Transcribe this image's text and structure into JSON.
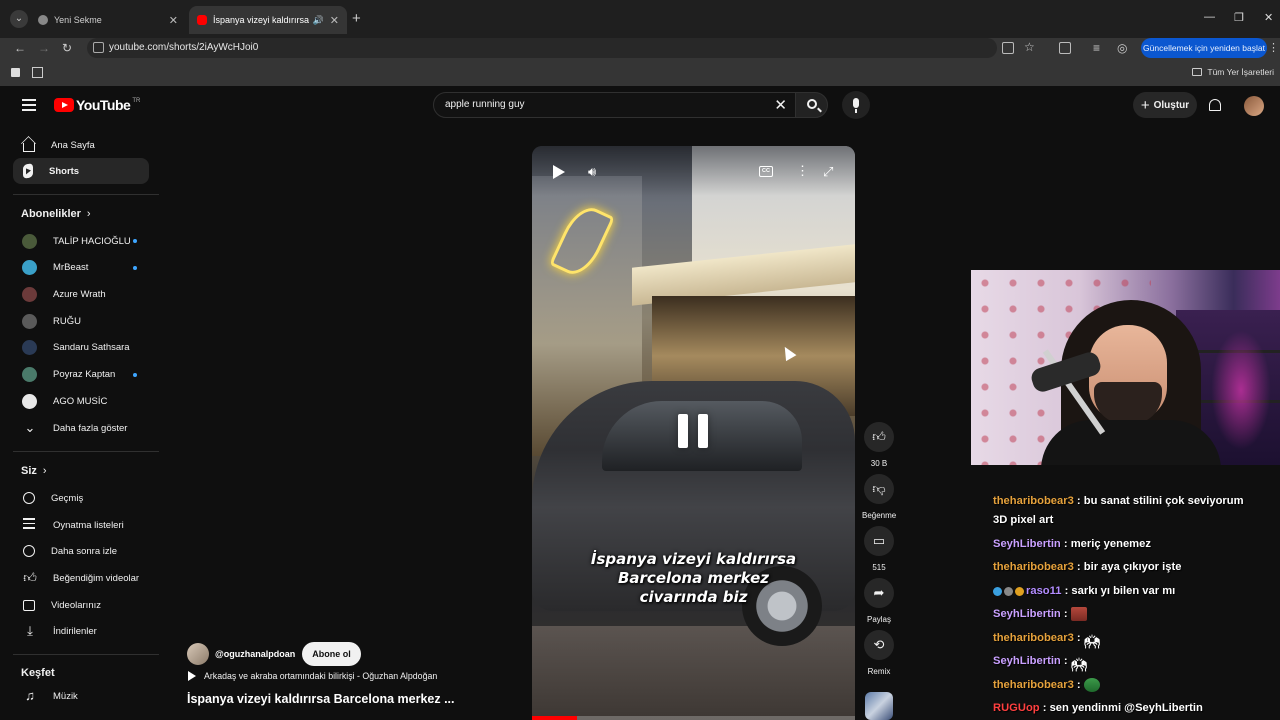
{
  "browser": {
    "tabs": [
      {
        "title": "Yeni Sekme",
        "active": false
      },
      {
        "title": "İspanya vizeyi kaldırırsa Barcelona merkez civarında biz",
        "active": true,
        "audible": true
      }
    ],
    "url": "youtube.com/shorts/2iAyWcHJoi0",
    "update_button": "Güncellemek için yeniden başlat",
    "all_bookmarks": "Tüm Yer İşaretleri",
    "colors": {
      "update": "#0b57d0",
      "tab_strip": "#1f1f1f"
    }
  },
  "youtube": {
    "logo": "YouTube",
    "country_code": "TR",
    "search_query": "apple running guy",
    "create_label": "Oluştur",
    "brand_color": "#ff0000"
  },
  "sidebar": {
    "main": [
      {
        "label": "Ana Sayfa",
        "icon": "home-icon"
      },
      {
        "label": "Shorts",
        "icon": "shorts-icon",
        "active": true
      }
    ],
    "subscriptions_header": "Abonelikler",
    "subscriptions": [
      {
        "label": "TALİP HACIOĞLU",
        "new": true,
        "color": "#4a5a3a"
      },
      {
        "label": "MrBeast",
        "new": true,
        "color": "#3aa0c8"
      },
      {
        "label": "Azure Wrath",
        "new": false,
        "color": "#6b3a3a"
      },
      {
        "label": "RUĞU",
        "new": false,
        "color": "#5a5a5a"
      },
      {
        "label": "Sandaru Sathsara",
        "new": false,
        "color": "#2a3a55"
      },
      {
        "label": "Poyraz Kaptan",
        "new": true,
        "color": "#4a7a6a"
      },
      {
        "label": "AGO MUSİC",
        "new": false,
        "color": "#e8e8e8"
      }
    ],
    "show_more": "Daha fazla göster",
    "you_header": "Siz",
    "you_items": [
      {
        "label": "Geçmiş",
        "icon": "history-icon"
      },
      {
        "label": "Oynatma listeleri",
        "icon": "playlist-icon"
      },
      {
        "label": "Daha sonra izle",
        "icon": "clock-icon"
      },
      {
        "label": "Beğendiğim videolar",
        "icon": "thumb-up-icon"
      },
      {
        "label": "Videolarınız",
        "icon": "your-videos-icon"
      },
      {
        "label": "İndirilenler",
        "icon": "download-icon"
      }
    ],
    "explore_header": "Keşfet",
    "explore_items": [
      {
        "label": "Müzik",
        "icon": "music-icon"
      }
    ]
  },
  "short": {
    "caption_lines": [
      "İspanya vizeyi kaldırırsa",
      "Barcelona merkez",
      "civarında biz"
    ],
    "channel": "@oguzhanalpdoan",
    "subscribe": "Abone ol",
    "music": "Arkadaş ve akraba ortamındaki bilirkişi - Oğuzhan Alpdoğan",
    "title": "İspanya vizeyi kaldırırsa Barcelona merkez ...",
    "progress_fraction": 0.14,
    "actions": [
      {
        "icon": "thumb-up-icon",
        "label": "30 B"
      },
      {
        "icon": "thumb-down-icon",
        "label": "Beğenme"
      },
      {
        "icon": "comment-icon",
        "label": "515"
      },
      {
        "icon": "share-icon",
        "label": "Paylaş"
      },
      {
        "icon": "remix-icon",
        "label": "Remix"
      }
    ]
  },
  "chat": [
    {
      "user": "theharibobear3",
      "color": "#e6a23c",
      "text": "bu sanat stilini çok seviyorum",
      "text2": "3D pixel art"
    },
    {
      "user": "SeyhLibertin",
      "color": "#c9a0ff",
      "text": "meriç yenemez"
    },
    {
      "user": "theharibobear3",
      "color": "#e6a23c",
      "text": "bir aya çıkıyor işte"
    },
    {
      "user": "raso11",
      "color": "#b28cff",
      "text": "sarkı yı bilen var mı",
      "badges": true
    },
    {
      "user": "SeyhLibertin",
      "color": "#c9a0ff",
      "text": "",
      "emote": "brick"
    },
    {
      "user": "theharibobear3",
      "color": "#e6a23c",
      "text": "",
      "emote": "hand"
    },
    {
      "user": "SeyhLibertin",
      "color": "#c9a0ff",
      "text": "",
      "emote": "hand"
    },
    {
      "user": "theharibobear3",
      "color": "#e6a23c",
      "text": "",
      "emote": "bag"
    },
    {
      "user": "RUGUop",
      "color": "#ff4040",
      "text": "sen yendinmi @SeyhLibertin"
    }
  ]
}
